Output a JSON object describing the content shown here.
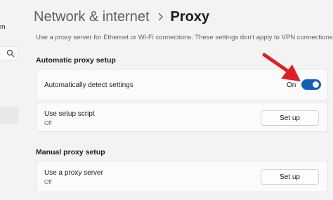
{
  "sidebar": {
    "username_fragment": "m"
  },
  "header": {
    "breadcrumb_parent": "Network & internet",
    "breadcrumb_current": "Proxy"
  },
  "description": "Use a proxy server for Ethernet or Wi-Fi connections. These settings don't apply to VPN connections.",
  "automatic_section": {
    "title": "Automatic proxy setup",
    "detect": {
      "label": "Automatically detect settings",
      "state_label": "On",
      "toggle_on": true
    },
    "script": {
      "label": "Use setup script",
      "sub": "Off",
      "button": "Set up"
    }
  },
  "manual_section": {
    "title": "Manual proxy setup",
    "proxy_server": {
      "label": "Use a proxy server",
      "sub": "Off",
      "button": "Set up"
    }
  },
  "colors": {
    "accent": "#0f62b8",
    "annotation_arrow": "#e11d26",
    "background": "#f3f3f3",
    "card": "#fbfbfb"
  },
  "icons": {
    "search": "search-icon",
    "separator": "chevron-right-icon",
    "annotation": "red-arrow-annotation"
  }
}
